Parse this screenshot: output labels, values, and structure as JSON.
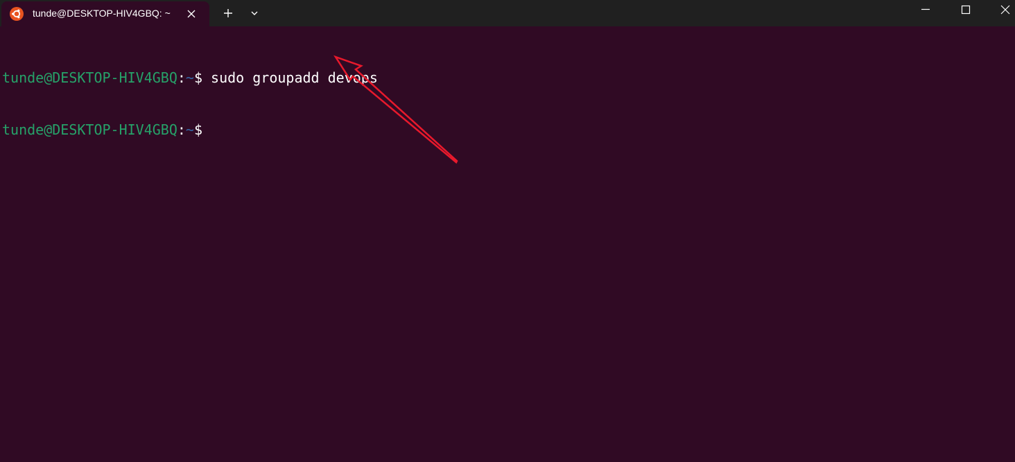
{
  "tab": {
    "title": "tunde@DESKTOP-HIV4GBQ: ~",
    "icon": "ubuntu-icon",
    "close_icon": "close-icon"
  },
  "tabbar": {
    "new_tab_icon": "plus-icon",
    "dropdown_icon": "chevron-down-icon"
  },
  "window_controls": {
    "minimize_icon": "minimize-icon",
    "maximize_icon": "maximize-icon",
    "close_icon": "close-icon"
  },
  "terminal": {
    "lines": [
      {
        "user": "tunde@DESKTOP-HIV4GBQ",
        "colon": ":",
        "path": "~",
        "dollar": "$",
        "command": " sudo groupadd devops"
      },
      {
        "user": "tunde@DESKTOP-HIV4GBQ",
        "colon": ":",
        "path": "~",
        "dollar": "$",
        "command": ""
      }
    ]
  },
  "colors": {
    "background": "#300a24",
    "titlebar": "#202020",
    "user": "#26a269",
    "path": "#3465a4",
    "annotation_arrow": "#e8192c"
  },
  "annotation": {
    "arrow_icon": "annotation-arrow"
  }
}
